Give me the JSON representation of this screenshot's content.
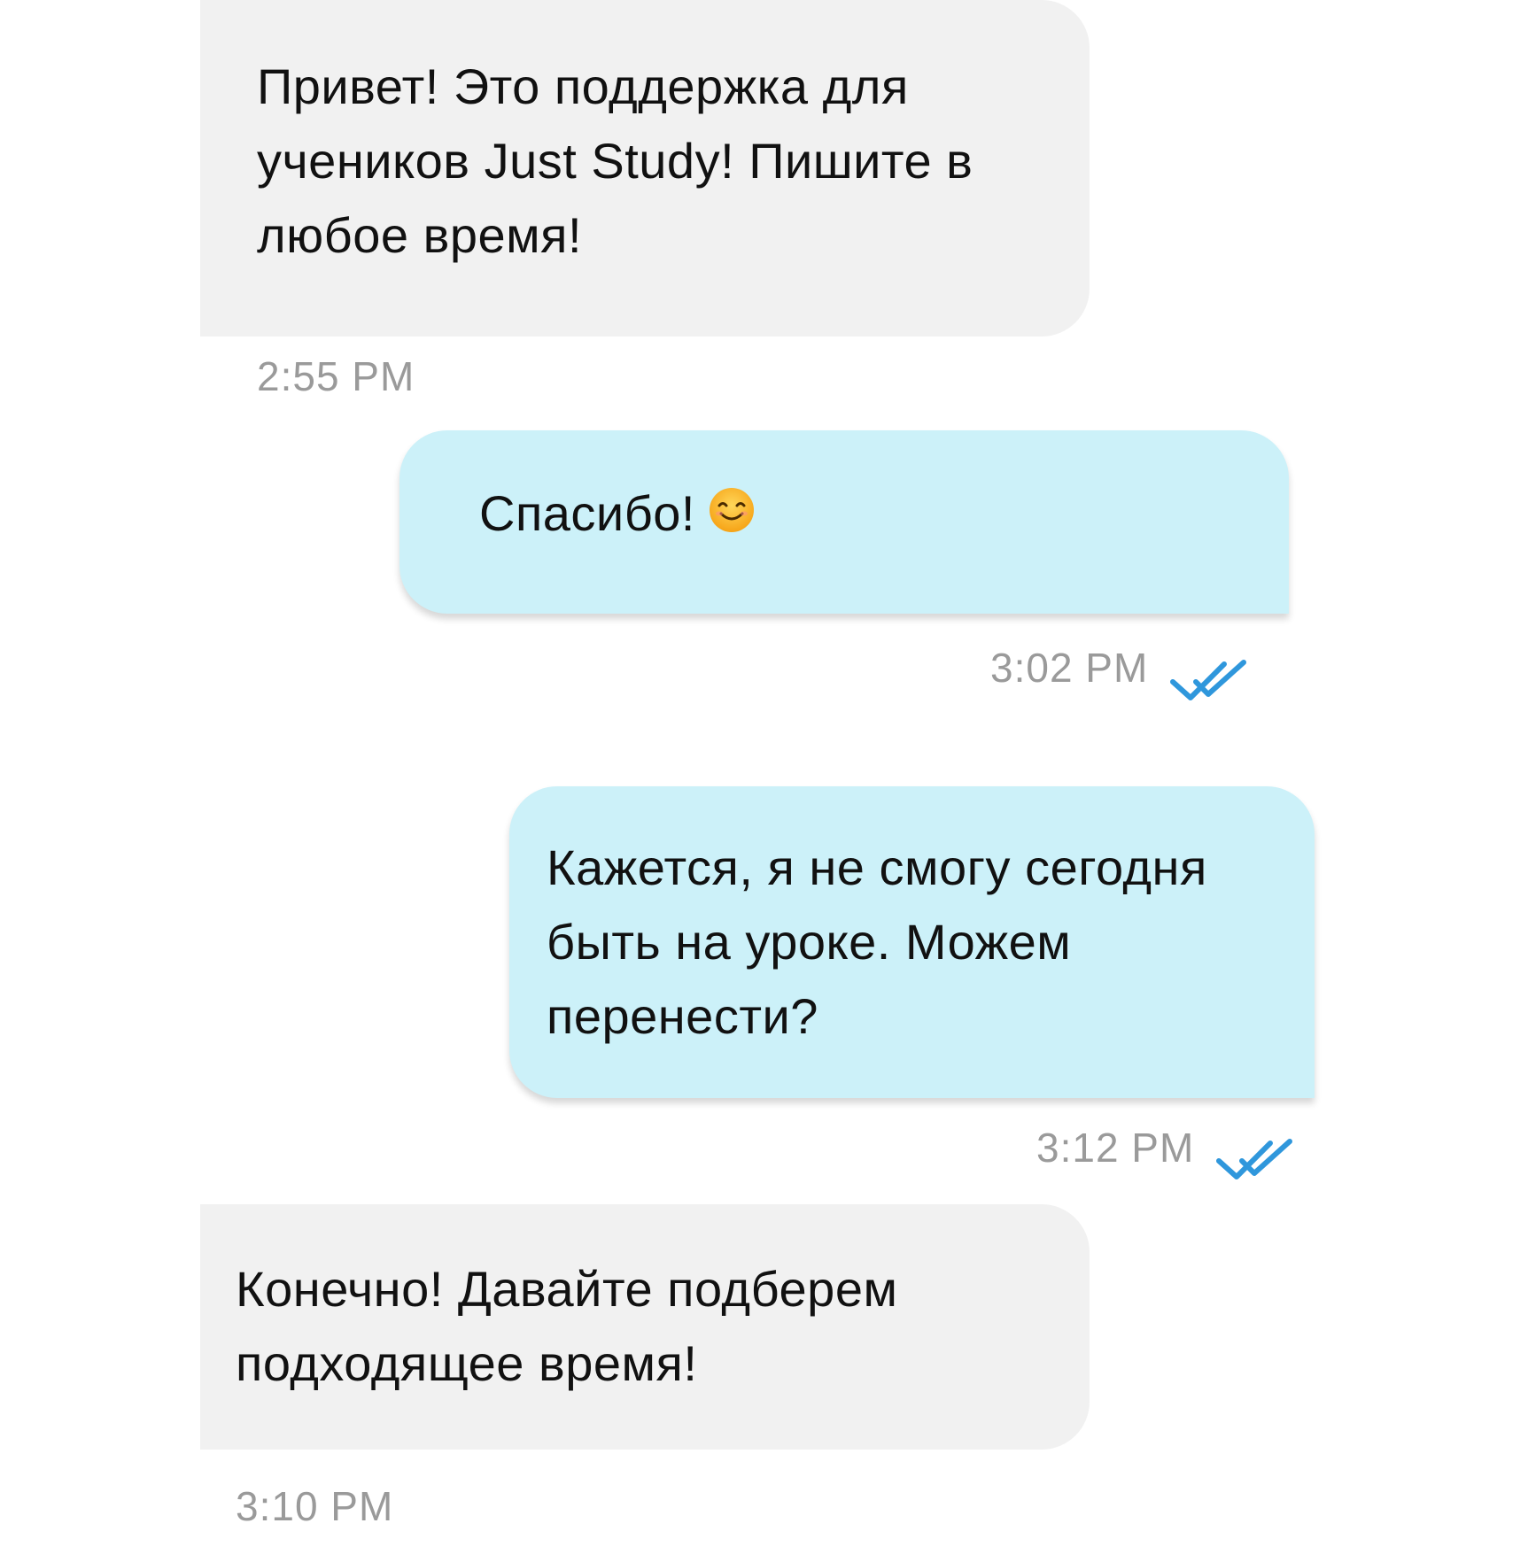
{
  "messages": [
    {
      "direction": "incoming",
      "lines": [
        "Привет! Это поддержка для",
        "учеников Just Study! Пишите в",
        "любое время!"
      ],
      "time": "2:55 PM"
    },
    {
      "direction": "outgoing",
      "text": "Спасибо!",
      "emoji": "smiling-face-icon",
      "time": "3:02 PM",
      "status": "read"
    },
    {
      "direction": "outgoing",
      "lines": [
        "Кажется, я не смогу сегодня",
        "быть на уроке. Можем",
        "перенести?"
      ],
      "time": "3:12 PM",
      "status": "read"
    },
    {
      "direction": "incoming",
      "lines": [
        "Конечно! Давайте подберем",
        "подходящее время!"
      ],
      "time": "3:10 PM"
    }
  ],
  "colors": {
    "incoming_bubble": "#f1f1f1",
    "outgoing_bubble": "#ccf1f9",
    "timestamp": "#9a9a9a",
    "read_ticks": "#2f97dc"
  }
}
